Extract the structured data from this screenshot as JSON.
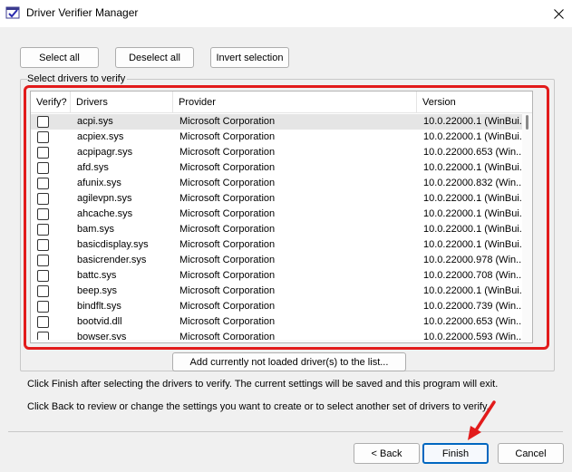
{
  "window": {
    "title": "Driver Verifier Manager"
  },
  "toolbar": {
    "select_all": "Select all",
    "deselect_all": "Deselect all",
    "invert_selection": "Invert selection"
  },
  "group": {
    "label": "Select drivers to verify"
  },
  "table": {
    "columns": [
      "Verify?",
      "Drivers",
      "Provider",
      "Version"
    ],
    "rows": [
      {
        "checked": false,
        "driver": "acpi.sys",
        "provider": "Microsoft Corporation",
        "version": "10.0.22000.1 (WinBui..."
      },
      {
        "checked": false,
        "driver": "acpiex.sys",
        "provider": "Microsoft Corporation",
        "version": "10.0.22000.1 (WinBui..."
      },
      {
        "checked": false,
        "driver": "acpipagr.sys",
        "provider": "Microsoft Corporation",
        "version": "10.0.22000.653 (Win..."
      },
      {
        "checked": false,
        "driver": "afd.sys",
        "provider": "Microsoft Corporation",
        "version": "10.0.22000.1 (WinBui..."
      },
      {
        "checked": false,
        "driver": "afunix.sys",
        "provider": "Microsoft Corporation",
        "version": "10.0.22000.832 (Win..."
      },
      {
        "checked": false,
        "driver": "agilevpn.sys",
        "provider": "Microsoft Corporation",
        "version": "10.0.22000.1 (WinBui..."
      },
      {
        "checked": false,
        "driver": "ahcache.sys",
        "provider": "Microsoft Corporation",
        "version": "10.0.22000.1 (WinBui..."
      },
      {
        "checked": false,
        "driver": "bam.sys",
        "provider": "Microsoft Corporation",
        "version": "10.0.22000.1 (WinBui..."
      },
      {
        "checked": false,
        "driver": "basicdisplay.sys",
        "provider": "Microsoft Corporation",
        "version": "10.0.22000.1 (WinBui..."
      },
      {
        "checked": false,
        "driver": "basicrender.sys",
        "provider": "Microsoft Corporation",
        "version": "10.0.22000.978 (Win..."
      },
      {
        "checked": false,
        "driver": "battc.sys",
        "provider": "Microsoft Corporation",
        "version": "10.0.22000.708 (Win..."
      },
      {
        "checked": false,
        "driver": "beep.sys",
        "provider": "Microsoft Corporation",
        "version": "10.0.22000.1 (WinBui..."
      },
      {
        "checked": false,
        "driver": "bindflt.sys",
        "provider": "Microsoft Corporation",
        "version": "10.0.22000.739 (Win..."
      },
      {
        "checked": false,
        "driver": "bootvid.dll",
        "provider": "Microsoft Corporation",
        "version": "10.0.22000.653 (Win..."
      },
      {
        "checked": false,
        "driver": "bowser.sys",
        "provider": "Microsoft Corporation",
        "version": "10.0.22000.593 (Win..."
      }
    ]
  },
  "add_button": {
    "label": "Add currently not loaded driver(s) to the list..."
  },
  "info": {
    "line1": "Click Finish after selecting the drivers to verify. The current settings will be saved and this program will exit.",
    "line2": "Click Back to review or change the settings you want to create or to select another set of drivers to verify."
  },
  "footer": {
    "back": "< Back",
    "finish": "Finish",
    "cancel": "Cancel"
  },
  "colors": {
    "highlight": "#e21b1b",
    "accent": "#0067c0"
  },
  "icons": [
    "driver-verifier-app-icon",
    "close-icon",
    "checkbox-icon",
    "red-arrow-annotation"
  ]
}
